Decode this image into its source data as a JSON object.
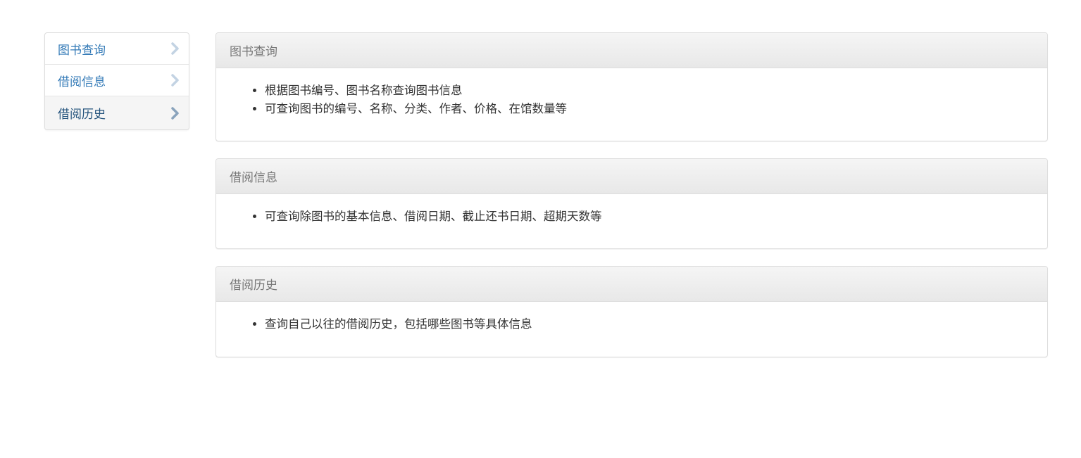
{
  "sidebar": {
    "items": [
      {
        "label": "图书查询",
        "icon": "chevron-right-icon",
        "active": false
      },
      {
        "label": "借阅信息",
        "icon": "chevron-right-icon",
        "active": false
      },
      {
        "label": "借阅历史",
        "icon": "chevron-right-icon",
        "active": true
      }
    ]
  },
  "panels": [
    {
      "title": "图书查询",
      "items": [
        "根据图书编号、图书名称查询图书信息",
        "可查询图书的编号、名称、分类、作者、价格、在馆数量等"
      ]
    },
    {
      "title": "借阅信息",
      "items": [
        "可查询除图书的基本信息、借阅日期、截止还书日期、超期天数等"
      ]
    },
    {
      "title": "借阅历史",
      "items": [
        "查询自己以往的借阅历史，包括哪些图书等具体信息"
      ]
    }
  ],
  "colors": {
    "link": "#337ab7",
    "link_active": "#23527c",
    "chevron": "#c3d3e3",
    "chevron_active": "#8aa3bc",
    "heading_text": "#777777",
    "border": "#dddddd"
  }
}
